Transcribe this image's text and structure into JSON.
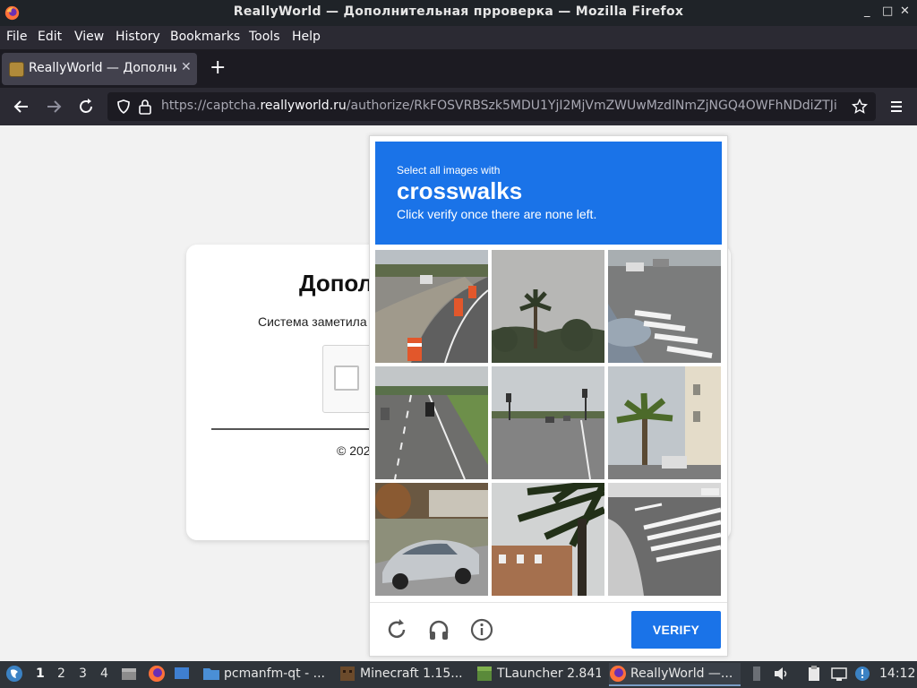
{
  "window": {
    "title": "ReallyWorld — Дополнительная прроверка — Mozilla Firefox",
    "controls": [
      "_",
      "□",
      "✕"
    ]
  },
  "menu": {
    "items": [
      "File",
      "Edit",
      "View",
      "History",
      "Bookmarks",
      "Tools",
      "Help"
    ]
  },
  "tab": {
    "label": "ReallyWorld — Дополнит",
    "close": "✕",
    "new_tab": "+"
  },
  "nav": {
    "url_prefix": "https://captcha.",
    "url_domain": "reallyworld.ru",
    "url_path": "/authorize/RkFOSVRBSzk5MDU1YjI2MjVmZWUwMzdlNmZjNGQ4OWFhNDdiZTJi"
  },
  "page": {
    "heading": "Допол",
    "subtext": "Система заметила",
    "copyright": "© 202"
  },
  "captcha": {
    "line1": "Select all images with",
    "keyword": "crosswalks",
    "line3": "Click verify once there are none left.",
    "verify_label": "VERIFY",
    "tiles": [
      "road-construction-cones",
      "palm-tree-sky",
      "street-crosswalk-car",
      "highway-motorcycle",
      "road-intersection-traffic-lights",
      "palm-tree-building",
      "parked-silver-car",
      "palm-fronds-building",
      "crosswalk-corner"
    ]
  },
  "taskbar": {
    "workspaces": [
      "1",
      "2",
      "3",
      "4"
    ],
    "tasks": [
      {
        "label": "pcmanfm-qt - ..."
      },
      {
        "label": "Minecraft 1.15..."
      },
      {
        "label": "TLauncher 2.841"
      },
      {
        "label": "ReallyWorld —..."
      }
    ],
    "clock": "14:12"
  },
  "colors": {
    "captcha_blue": "#1a73e8",
    "chrome_dark": "#2b2a33"
  }
}
